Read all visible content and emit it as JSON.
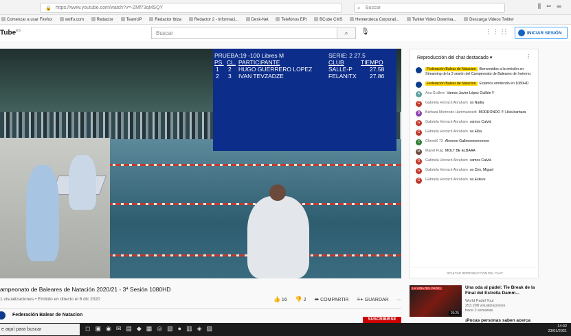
{
  "browser": {
    "url": "https://www.youtube.com/watch?v=-ZMf73qMSQY",
    "search_placeholder": "Buscar"
  },
  "bookmarks": [
    "Comenzar a usar Firefox",
    "woffu.com",
    "Redactor",
    "TeamUP",
    "Redactor Ibiza",
    "Redactor 2 - Informaci...",
    "Desk-Net",
    "Telefonos EPI",
    "BCube CMS",
    "Hemeroteca Corporati...",
    "Twitter Video Downloa...",
    "Descarga Videos Twitter"
  ],
  "youtube": {
    "logo": "Tube",
    "logo_region": "ES",
    "search_placeholder": "Buscar",
    "signin_label": "INICIAR SESIÓN"
  },
  "scoreboard": {
    "event": "PRUEBA:19  -100 Libres M",
    "heat": "SERIE:  2  27.5",
    "h_pos": "PS.",
    "h_lane": "CL.",
    "h_name": "PARTICIPANTE",
    "h_club": "CLUB",
    "h_time": "TIEMPO",
    "rows": [
      {
        "pos": "1",
        "lane": "2",
        "name": "HUGO GUERRERO LOPEZ",
        "club": "SALLE-P",
        "time": "27.58"
      },
      {
        "pos": "2",
        "lane": "3",
        "name": "IVAN TEVZADZE",
        "club": "FELANITX",
        "time": "27.86"
      }
    ]
  },
  "video": {
    "title": "ampeonato de Baleares de Natación 2020/21 - 3ª Sesión 1080HD",
    "meta": "1 visualizaciones • Emitido en directo el 6 dic 2020",
    "likes": "16",
    "dislikes": "2",
    "share": "COMPARTIR",
    "save": "GUARDAR",
    "channel": "Federación Balear de Natacion",
    "subscribe": "SUSCRIBIRSE"
  },
  "chat": {
    "header": "Reproducción del chat destacado",
    "footer": "OCULTAR REPRODUCCIÓN DEL CHAT",
    "messages": [
      {
        "name": "Federación Balear de Natacion",
        "text": "Bienvenidos a la emisión en Streaming de la 3 sesión del Campeonato de Baleares de Invierno.",
        "owner": true,
        "initial": "",
        "color": "#0b3b8c"
      },
      {
        "name": "Federación Balear de Natacion",
        "text": "Estamos emitiendo en 1080HD",
        "owner": true,
        "initial": "",
        "color": "#0b3b8c"
      },
      {
        "name": "Ana Guillem",
        "text": "Vamos Javier López Guillén !!",
        "owner": false,
        "initial": "A",
        "color": "#5f9ea0"
      },
      {
        "name": "Gabriela Horrach Abraham",
        "text": "va Nadia",
        "owner": false,
        "initial": "G",
        "color": "#c0392b"
      },
      {
        "name": "Bárbara Morrondo Hammarstedt",
        "text": "MORRONDO !!! Hola barbara",
        "owner": false,
        "initial": "B",
        "color": "#8e44ad"
      },
      {
        "name": "Gabriela Horrach Abraham",
        "text": "vamos Calvià",
        "owner": false,
        "initial": "G",
        "color": "#c0392b"
      },
      {
        "name": "Gabriela Horrach Abraham",
        "text": "va Elba",
        "owner": false,
        "initial": "G",
        "color": "#c0392b"
      },
      {
        "name": "ChemiX 73",
        "text": "Aleeeee Galleeeeeeeeeeee",
        "owner": false,
        "initial": "C",
        "color": "#2e7d32"
      },
      {
        "name": "Manel Puig",
        "text": "MOLT BE ELBAAA",
        "owner": false,
        "initial": "M",
        "color": "#6d4c41"
      },
      {
        "name": "Gabriela Horrach Abraham",
        "text": "vamos Calvià",
        "owner": false,
        "initial": "G",
        "color": "#c0392b"
      },
      {
        "name": "Gabriela Horrach Abraham",
        "text": "va Ciro, Miguel",
        "owner": false,
        "initial": "G",
        "color": "#c0392b"
      },
      {
        "name": "Gabriela Horrach Abraham",
        "text": "va Esteve",
        "owner": false,
        "initial": "G",
        "color": "#c0392b"
      }
    ]
  },
  "recommended": [
    {
      "tag": "LA VIDA DEL PADEL",
      "duration": "19:25",
      "title": "Una oda al pádel: Tie Break de la Final del Estrella Damm...",
      "channel": "World Padel Tour",
      "views": "253.208 visualizaciones",
      "age": "hace 2 semanas"
    },
    {
      "title": "¡Pocas personas saben acerca"
    }
  ],
  "taskbar": {
    "search": "e aquí para buscar",
    "time": "14:02",
    "date": "23/01/2021"
  }
}
